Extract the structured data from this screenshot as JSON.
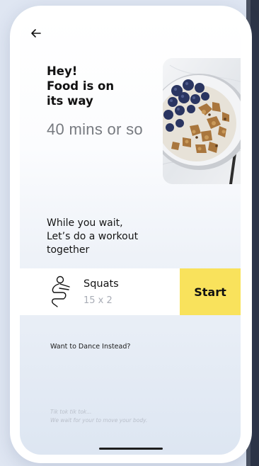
{
  "header": {
    "back_icon": "arrow-left-icon"
  },
  "hero": {
    "title_lines": [
      "Hey!",
      "Food is on",
      "its way"
    ],
    "eta": "40 mins or so",
    "image": "granola-blueberry-bowl"
  },
  "prompt": {
    "lines": [
      "While you wait,",
      "Let’s do a workout",
      "together"
    ]
  },
  "workout": {
    "icon": "squat-figure-icon",
    "name": "Squats",
    "reps": "15 x 2",
    "start_label": "Start",
    "start_color": "#f9e25c"
  },
  "alternative": {
    "link_text": "Want to Dance Instead?"
  },
  "footnote": {
    "lines": [
      "Tik tok tik tok...",
      "We wait for your to move your body."
    ]
  }
}
